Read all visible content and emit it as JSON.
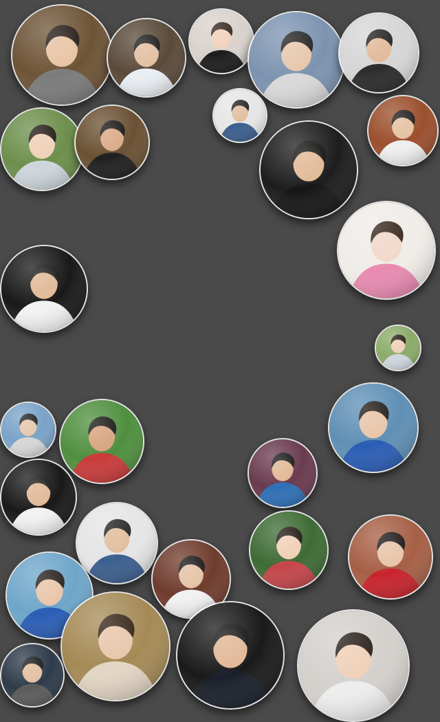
{
  "bubbles": [
    {
      "id": "p01",
      "bg": "#6e5437",
      "skin": "#e7c2a3",
      "shirt": "#7b7b7b",
      "hair": "#1b1410"
    },
    {
      "id": "p02",
      "bg": "#5a4a3a",
      "skin": "#e2bea0",
      "shirt": "#e9eef3",
      "hair": "#151515"
    },
    {
      "id": "p03",
      "bg": "#d9d2cc",
      "skin": "#f0d1bb",
      "shirt": "#1c1c1c",
      "hair": "#2a1b12"
    },
    {
      "id": "p04",
      "bg": "#7c93b0",
      "skin": "#e6c6ab",
      "shirt": "#d9d9d9",
      "hair": "#1a1a1a"
    },
    {
      "id": "p05",
      "bg": "#d6d6d6",
      "skin": "#e0b896",
      "shirt": "#2b2b2b",
      "hair": "#151515"
    },
    {
      "id": "p06",
      "bg": "#e6e6e6",
      "skin": "#e1bc9c",
      "shirt": "#3b5f8e",
      "hair": "#151515"
    },
    {
      "id": "p07",
      "bg": "#9b4f2d",
      "skin": "#e4c0a1",
      "shirt": "#efefef",
      "hair": "#151515"
    },
    {
      "id": "p08",
      "bg": "#6d8f4c",
      "skin": "#efcfb6",
      "shirt": "#cdd6dc",
      "hair": "#1a120d"
    },
    {
      "id": "p09",
      "bg": "#6b5134",
      "skin": "#d9a985",
      "shirt": "#1f1f1f",
      "hair": "#101010"
    },
    {
      "id": "p10",
      "bg": "#1d1d1d",
      "skin": "#e1b995",
      "shirt": "#161616",
      "hair": "#0f0f0f"
    },
    {
      "id": "p11",
      "bg": "#f0ece8",
      "skin": "#f1d7c8",
      "shirt": "#e88ab0",
      "hair": "#2b1a10"
    },
    {
      "id": "p12",
      "bg": "#191919",
      "skin": "#e0b895",
      "shirt": "#f2f2f2",
      "hair": "#141414"
    },
    {
      "id": "p13",
      "bg": "#8cab6a",
      "skin": "#efcfb6",
      "shirt": "#cfd7de",
      "hair": "#1a120d"
    },
    {
      "id": "p14",
      "bg": "#5f8fb5",
      "skin": "#e8c4a8",
      "shirt": "#2a5db5",
      "hair": "#1b140f"
    },
    {
      "id": "p15",
      "bg": "#7aa3c7",
      "skin": "#e6c6ab",
      "shirt": "#d7d7d7",
      "hair": "#1a1a1a"
    },
    {
      "id": "p16",
      "bg": "#4f8f3f",
      "skin": "#d7a27d",
      "shirt": "#c93a3a",
      "hair": "#121212"
    },
    {
      "id": "p17",
      "bg": "#6a3b4f",
      "skin": "#e1b795",
      "shirt": "#2e6fb6",
      "hair": "#141414"
    },
    {
      "id": "p18",
      "bg": "#191919",
      "skin": "#e0b895",
      "shirt": "#f2f2f2",
      "hair": "#141414"
    },
    {
      "id": "p19",
      "bg": "#e5e5e5",
      "skin": "#e1bc9c",
      "shirt": "#3b5f8e",
      "hair": "#151515"
    },
    {
      "id": "p20",
      "bg": "#6f3c2d",
      "skin": "#e4c2a5",
      "shirt": "#f1f1f1",
      "hair": "#111111"
    },
    {
      "id": "p21",
      "bg": "#3e6b35",
      "skin": "#efcfb6",
      "shirt": "#c4464b",
      "hair": "#1b120d"
    },
    {
      "id": "p22",
      "bg": "#a65f45",
      "skin": "#e7c3a7",
      "shirt": "#c8232d",
      "hair": "#111111"
    },
    {
      "id": "p23",
      "bg": "#6ea6c9",
      "skin": "#e8c4a8",
      "shirt": "#2a5db5",
      "hair": "#1b140f"
    },
    {
      "id": "p24",
      "bg": "#a58a56",
      "skin": "#e7c6ab",
      "shirt": "#e2d5c3",
      "hair": "#2b1c10"
    },
    {
      "id": "p25",
      "bg": "#1a1a1a",
      "skin": "#e1b795",
      "shirt": "#1a1f2a",
      "hair": "#121212"
    },
    {
      "id": "p26",
      "bg": "#d4d0cc",
      "skin": "#efcfb6",
      "shirt": "#ededed",
      "hair": "#1a120d"
    },
    {
      "id": "p27",
      "bg": "#2e3b4a",
      "skin": "#e2be9f",
      "shirt": "#5b5b5b",
      "hair": "#141414"
    }
  ]
}
